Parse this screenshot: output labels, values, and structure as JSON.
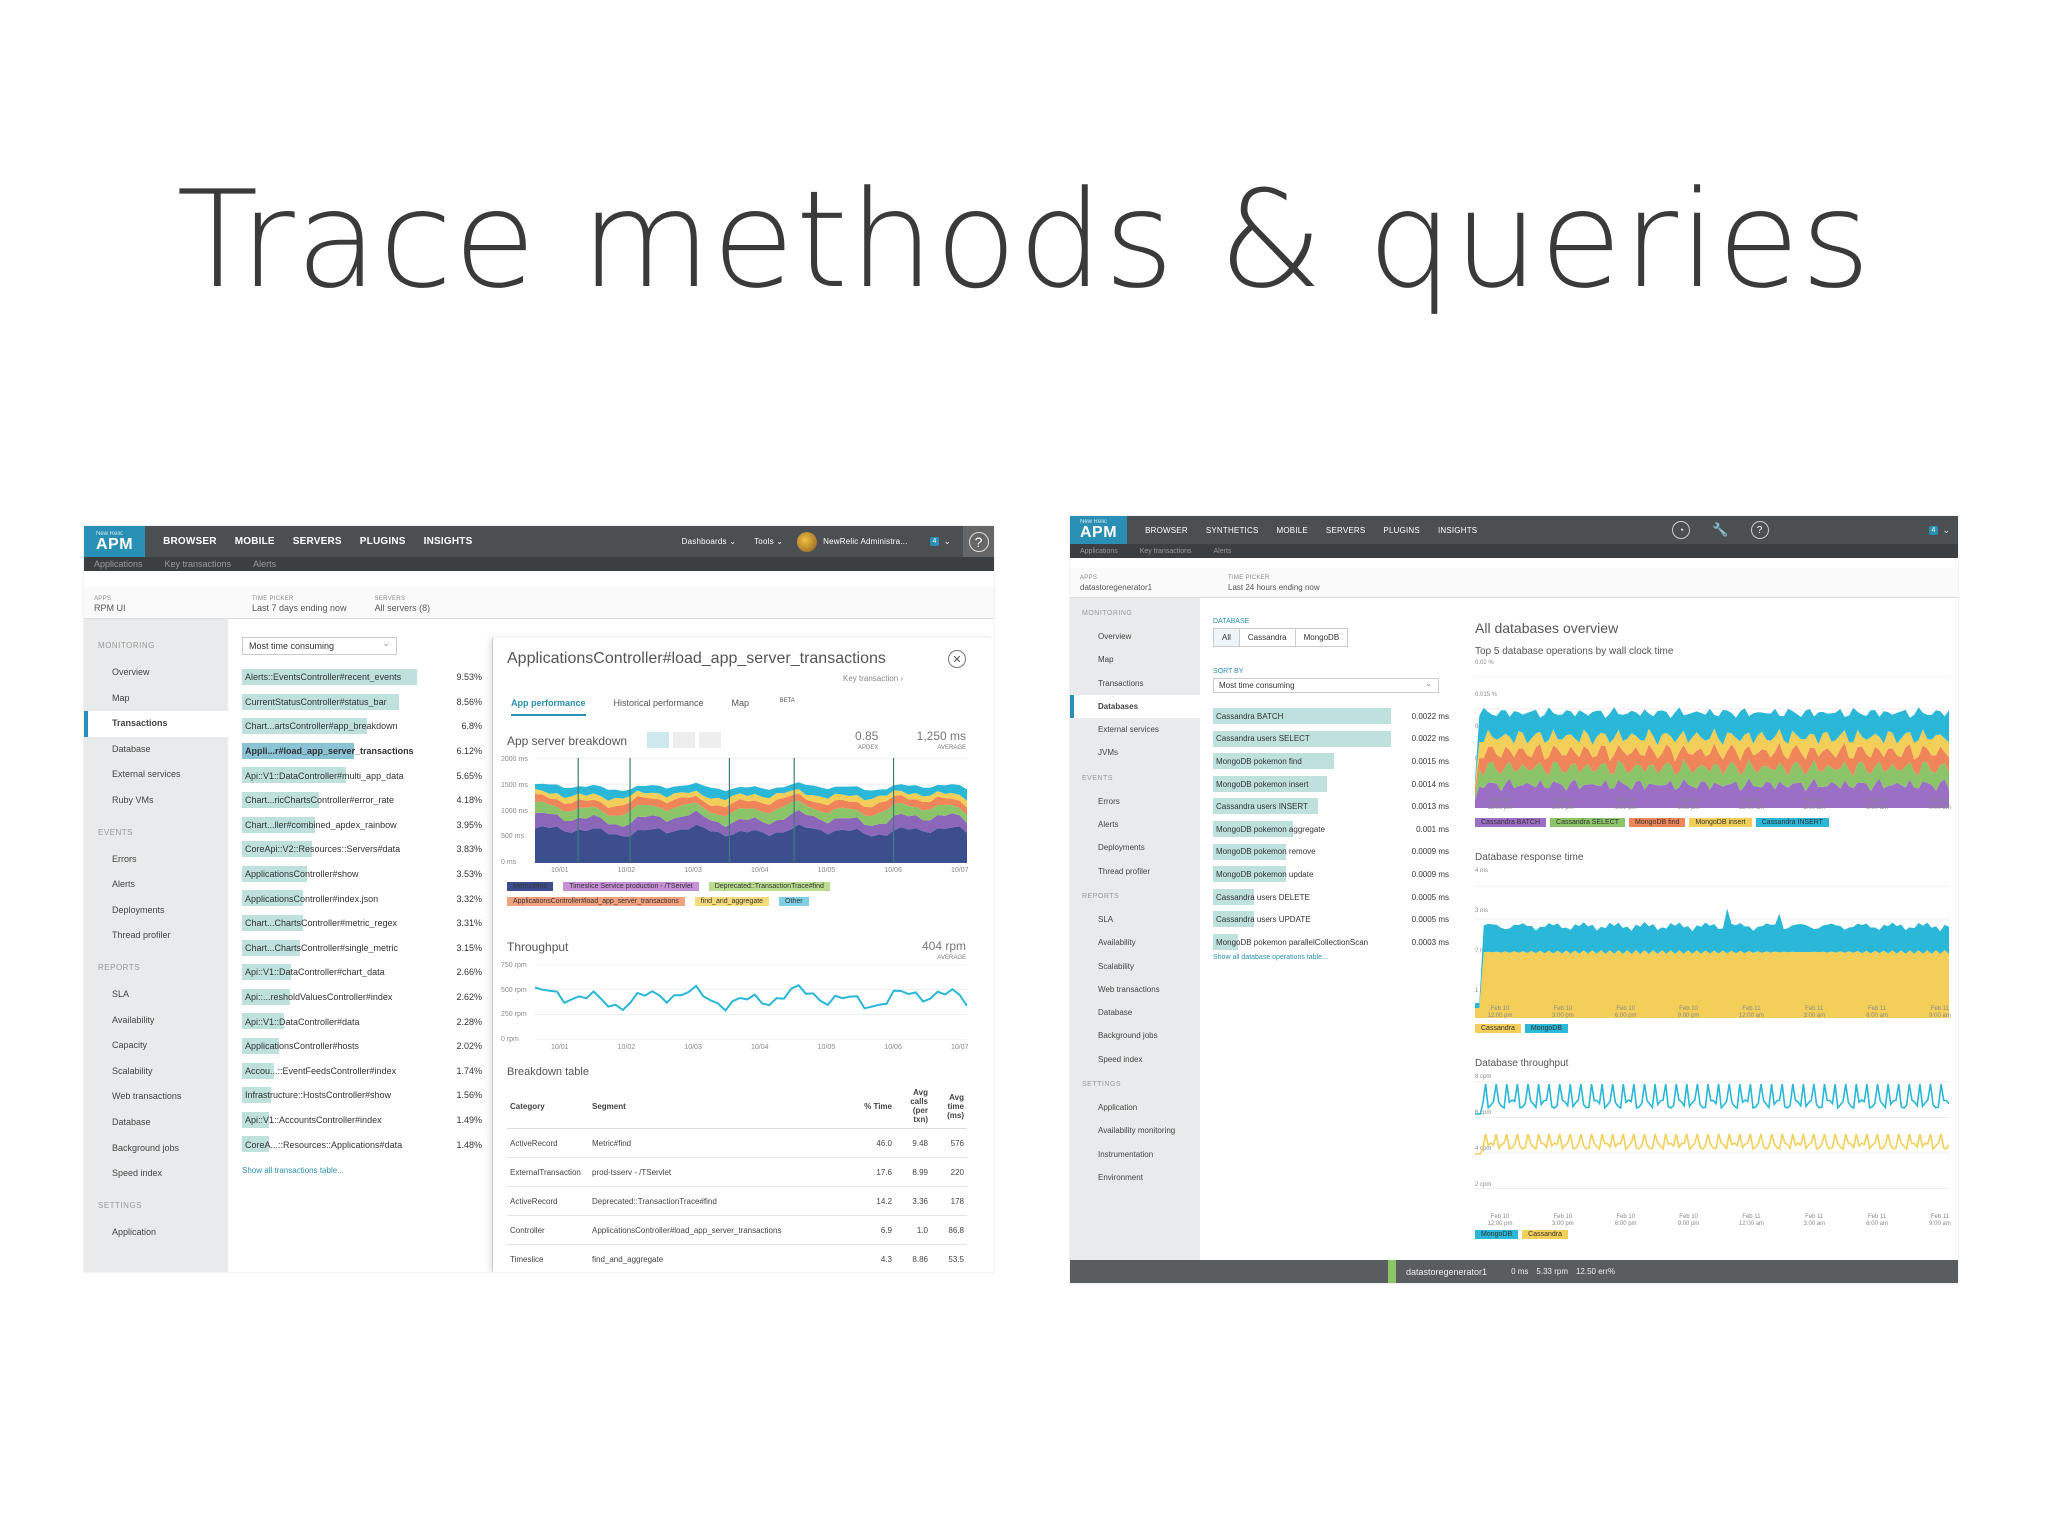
{
  "slide": {
    "title": "Trace methods & queries"
  },
  "colors": {
    "accent": "#2a8fb4",
    "teal": "#2ab7d8",
    "yellow": "#f3cf5a",
    "green": "#8cc46a",
    "orange": "#f0855a",
    "purple": "#8c66b8",
    "navy": "#3d4e8e"
  },
  "left": {
    "logo": {
      "small": "New Relic",
      "name": "APM"
    },
    "nav": [
      "BROWSER",
      "MOBILE",
      "SERVERS",
      "PLUGINS",
      "INSIGHTS"
    ],
    "nav_right": {
      "dashboards": "Dashboards",
      "tools": "Tools",
      "user": "NewRelic Administra...",
      "badge": "4"
    },
    "subnav": [
      "Applications",
      "Key transactions",
      "Alerts"
    ],
    "pickers": {
      "apps_caption": "APPS",
      "apps_value": "RPM UI",
      "time_caption": "TIME PICKER",
      "time_value": "Last 7 days ending now",
      "servers_caption": "SERVERS",
      "servers_value": "All servers (8)"
    },
    "sidebar": {
      "sections": [
        "MONITORING",
        "EVENTS",
        "REPORTS",
        "SETTINGS"
      ],
      "monitoring": [
        "Overview",
        "Map",
        "Transactions",
        "Database",
        "External services",
        "Ruby VMs"
      ],
      "events": [
        "Errors",
        "Alerts",
        "Deployments",
        "Thread profiler"
      ],
      "reports": [
        "SLA",
        "Availability",
        "Capacity",
        "Scalability",
        "Web transactions",
        "Database",
        "Background jobs",
        "Speed index"
      ],
      "settings": [
        "Application"
      ]
    },
    "sort_select": "Most time consuming",
    "transactions": [
      {
        "name": "Alerts::EventsController#recent_events",
        "value": "9.53%",
        "pct": 9.53
      },
      {
        "name": "CurrentStatusController#status_bar",
        "value": "8.56%",
        "pct": 8.56
      },
      {
        "name": "Chart...artsController#app_breakdown",
        "value": "6.8%",
        "pct": 6.8
      },
      {
        "name": "Appli...r#load_app_server_transactions",
        "value": "6.12%",
        "pct": 6.12
      },
      {
        "name": "Api::V1::DataController#multi_app_data",
        "value": "5.65%",
        "pct": 5.65
      },
      {
        "name": "Chart...ricChartsController#error_rate",
        "value": "4.18%",
        "pct": 4.18
      },
      {
        "name": "Chart...ller#combined_apdex_rainbow",
        "value": "3.95%",
        "pct": 3.95
      },
      {
        "name": "CoreApi::V2::Resources::Servers#data",
        "value": "3.83%",
        "pct": 3.83
      },
      {
        "name": "ApplicationsController#show",
        "value": "3.53%",
        "pct": 3.53
      },
      {
        "name": "ApplicationsController#index.json",
        "value": "3.32%",
        "pct": 3.32
      },
      {
        "name": "Chart...ChartsController#metric_regex",
        "value": "3.31%",
        "pct": 3.31
      },
      {
        "name": "Chart...ChartsController#single_metric",
        "value": "3.15%",
        "pct": 3.15
      },
      {
        "name": "Api::V1::DataController#chart_data",
        "value": "2.66%",
        "pct": 2.66
      },
      {
        "name": "Api::...resholdValuesController#index",
        "value": "2.62%",
        "pct": 2.62
      },
      {
        "name": "Api::V1::DataController#data",
        "value": "2.28%",
        "pct": 2.28
      },
      {
        "name": "ApplicationsController#hosts",
        "value": "2.02%",
        "pct": 2.02
      },
      {
        "name": "Accou...::EventFeedsController#index",
        "value": "1.74%",
        "pct": 1.74
      },
      {
        "name": "Infrastructure::HostsController#show",
        "value": "1.56%",
        "pct": 1.56
      },
      {
        "name": "Api::V1::AccountsController#index",
        "value": "1.49%",
        "pct": 1.49
      },
      {
        "name": "CoreA...::Resources::Applications#data",
        "value": "1.48%",
        "pct": 1.48
      }
    ],
    "show_all": "Show all transactions table...",
    "panel": {
      "title": "ApplicationsController#load_app_server_transactions",
      "key_tx": "Key transaction",
      "tabs": [
        "App performance",
        "Historical performance",
        "Map"
      ],
      "map_beta": "BETA",
      "breakdown_label": "App server breakdown",
      "apdex_value": "0.85",
      "apdex_label": "APDEX",
      "avg_value": "1,250 ms",
      "avg_label": "AVERAGE",
      "y_ticks": [
        "2000 ms",
        "1500 ms",
        "1000 ms",
        "500 ms",
        "0 ms"
      ],
      "x_ticks": [
        "10/01",
        "10/02",
        "10/03",
        "10/04",
        "10/05",
        "10/06",
        "10/07"
      ],
      "legend": [
        {
          "label": "Metric#find",
          "color": "#3d4e8e"
        },
        {
          "label": "Timeslice Service production - /TServlet",
          "color": "#c78fd6"
        },
        {
          "label": "Deprecated::TransactionTrace#find",
          "color": "#b9dc8e"
        },
        {
          "label": "ApplicationsController#load_app_server_transactions",
          "color": "#f3a07e"
        },
        {
          "label": "find_and_aggregate",
          "color": "#f6db7a"
        },
        {
          "label": "Other",
          "color": "#7fd0e6"
        }
      ],
      "throughput_label": "Throughput",
      "throughput_value": "404 rpm",
      "throughput_sub": "AVERAGE",
      "tp_y_ticks": [
        "750 rpm",
        "500 rpm",
        "250 rpm",
        "0 rpm"
      ],
      "breakdown_table_label": "Breakdown table",
      "table_headers": [
        "Category",
        "Segment",
        "% Time",
        "Avg calls (per txn)",
        "Avg time (ms)"
      ],
      "table_rows": [
        [
          "ActiveRecord",
          "Metric#find",
          "46.0",
          "9.48",
          "576"
        ],
        [
          "ExternalTransaction",
          "prod-tsserv - /TServlet",
          "17.6",
          "8.99",
          "220"
        ],
        [
          "ActiveRecord",
          "Deprecated::TransactionTrace#find",
          "14.2",
          "3.36",
          "178"
        ],
        [
          "Controller",
          "ApplicationsController#load_app_server_transactions",
          "6.9",
          "1.0",
          "86.8"
        ],
        [
          "Timeslice",
          "find_and_aggregate",
          "4.3",
          "8.86",
          "53.5"
        ]
      ]
    }
  },
  "right": {
    "logo": {
      "small": "New Relic",
      "name": "APM"
    },
    "nav": [
      "BROWSER",
      "SYNTHETICS",
      "MOBILE",
      "SERVERS",
      "PLUGINS",
      "INSIGHTS"
    ],
    "badge": "4",
    "subnav": [
      "Applications",
      "Key transactions",
      "Alerts"
    ],
    "pickers": {
      "apps_caption": "APPS",
      "apps_value": "datastoregenerator1",
      "time_caption": "TIME PICKER",
      "time_value": "Last 24 hours ending now"
    },
    "sidebar": {
      "sections": [
        "MONITORING",
        "EVENTS",
        "REPORTS",
        "SETTINGS"
      ],
      "monitoring": [
        "Overview",
        "Map",
        "Transactions",
        "Databases",
        "External services",
        "JVMs"
      ],
      "events": [
        "Errors",
        "Alerts",
        "Deployments",
        "Thread profiler"
      ],
      "reports": [
        "SLA",
        "Availability",
        "Scalability",
        "Web transactions",
        "Database",
        "Background jobs",
        "Speed index"
      ],
      "settings": [
        "Application",
        "Availability monitoring",
        "Instrumentation",
        "Environment"
      ]
    },
    "database_caption": "DATABASE",
    "db_filters": [
      "All",
      "Cassandra",
      "MongoDB"
    ],
    "sort_caption": "SORT BY",
    "sort_select": "Most time consuming",
    "operations": [
      {
        "name": "Cassandra BATCH",
        "value": "0.0022 ms",
        "pct": 100
      },
      {
        "name": "Cassandra users SELECT",
        "value": "0.0022 ms",
        "pct": 100
      },
      {
        "name": "MongoDB pokemon find",
        "value": "0.0015 ms",
        "pct": 68
      },
      {
        "name": "MongoDB pokemon insert",
        "value": "0.0014 ms",
        "pct": 64
      },
      {
        "name": "Cassandra users INSERT",
        "value": "0.0013 ms",
        "pct": 59
      },
      {
        "name": "MongoDB pokemon aggregate",
        "value": "0.001 ms",
        "pct": 45
      },
      {
        "name": "MongoDB pokemon remove",
        "value": "0.0009 ms",
        "pct": 41
      },
      {
        "name": "MongoDB pokemon update",
        "value": "0.0009 ms",
        "pct": 41
      },
      {
        "name": "Cassandra users DELETE",
        "value": "0.0005 ms",
        "pct": 23
      },
      {
        "name": "Cassandra users UPDATE",
        "value": "0.0005 ms",
        "pct": 23
      },
      {
        "name": "MongoDB pokemon parallelCollectionScan",
        "value": "0.0003 ms",
        "pct": 14
      }
    ],
    "show_all": "Show all database operations table...",
    "overview_title": "All databases overview",
    "top5_label": "Top 5 database operations by wall clock time",
    "top5_y_ticks": [
      "0.02 %",
      "0.015 %",
      "0.01 %",
      "0.005 %"
    ],
    "x_ticks": [
      "Feb 10 12:00 pm",
      "Feb 10 3:00 pm",
      "Feb 10 6:00 pm",
      "Feb 10 9:00 pm",
      "Feb 11 12:00 am",
      "Feb 11 3:00 am",
      "Feb 11 6:00 am",
      "Feb 11 9:00 am"
    ],
    "top5_legend": [
      {
        "label": "Cassandra BATCH",
        "color": "#9c6fc7"
      },
      {
        "label": "Cassandra SELECT",
        "color": "#8cc46a"
      },
      {
        "label": "MongoDB find",
        "color": "#f0855a"
      },
      {
        "label": "MongoDB insert",
        "color": "#f3cf5a"
      },
      {
        "label": "Cassandra INSERT",
        "color": "#2ab7d8"
      }
    ],
    "response_label": "Database response time",
    "response_y_ticks": [
      "4 ms",
      "3 ms",
      "2 ms",
      "1 ms"
    ],
    "response_legend": [
      {
        "label": "Cassandra",
        "color": "#f3cf5a"
      },
      {
        "label": "MongoDB",
        "color": "#2ab7d8"
      }
    ],
    "throughput_label": "Database throughput",
    "throughput_y_ticks": [
      "8 cpm",
      "6 cpm",
      "4 cpm",
      "2 cpm"
    ],
    "throughput_legend": [
      {
        "label": "MongoDB",
        "color": "#2ab7d8"
      },
      {
        "label": "Cassandra",
        "color": "#f3cf5a"
      }
    ],
    "bottom": {
      "app": "datastoregenerator1",
      "ms": "0 ms",
      "rpm": "5.33 rpm",
      "err": "12.50 err%"
    }
  }
}
